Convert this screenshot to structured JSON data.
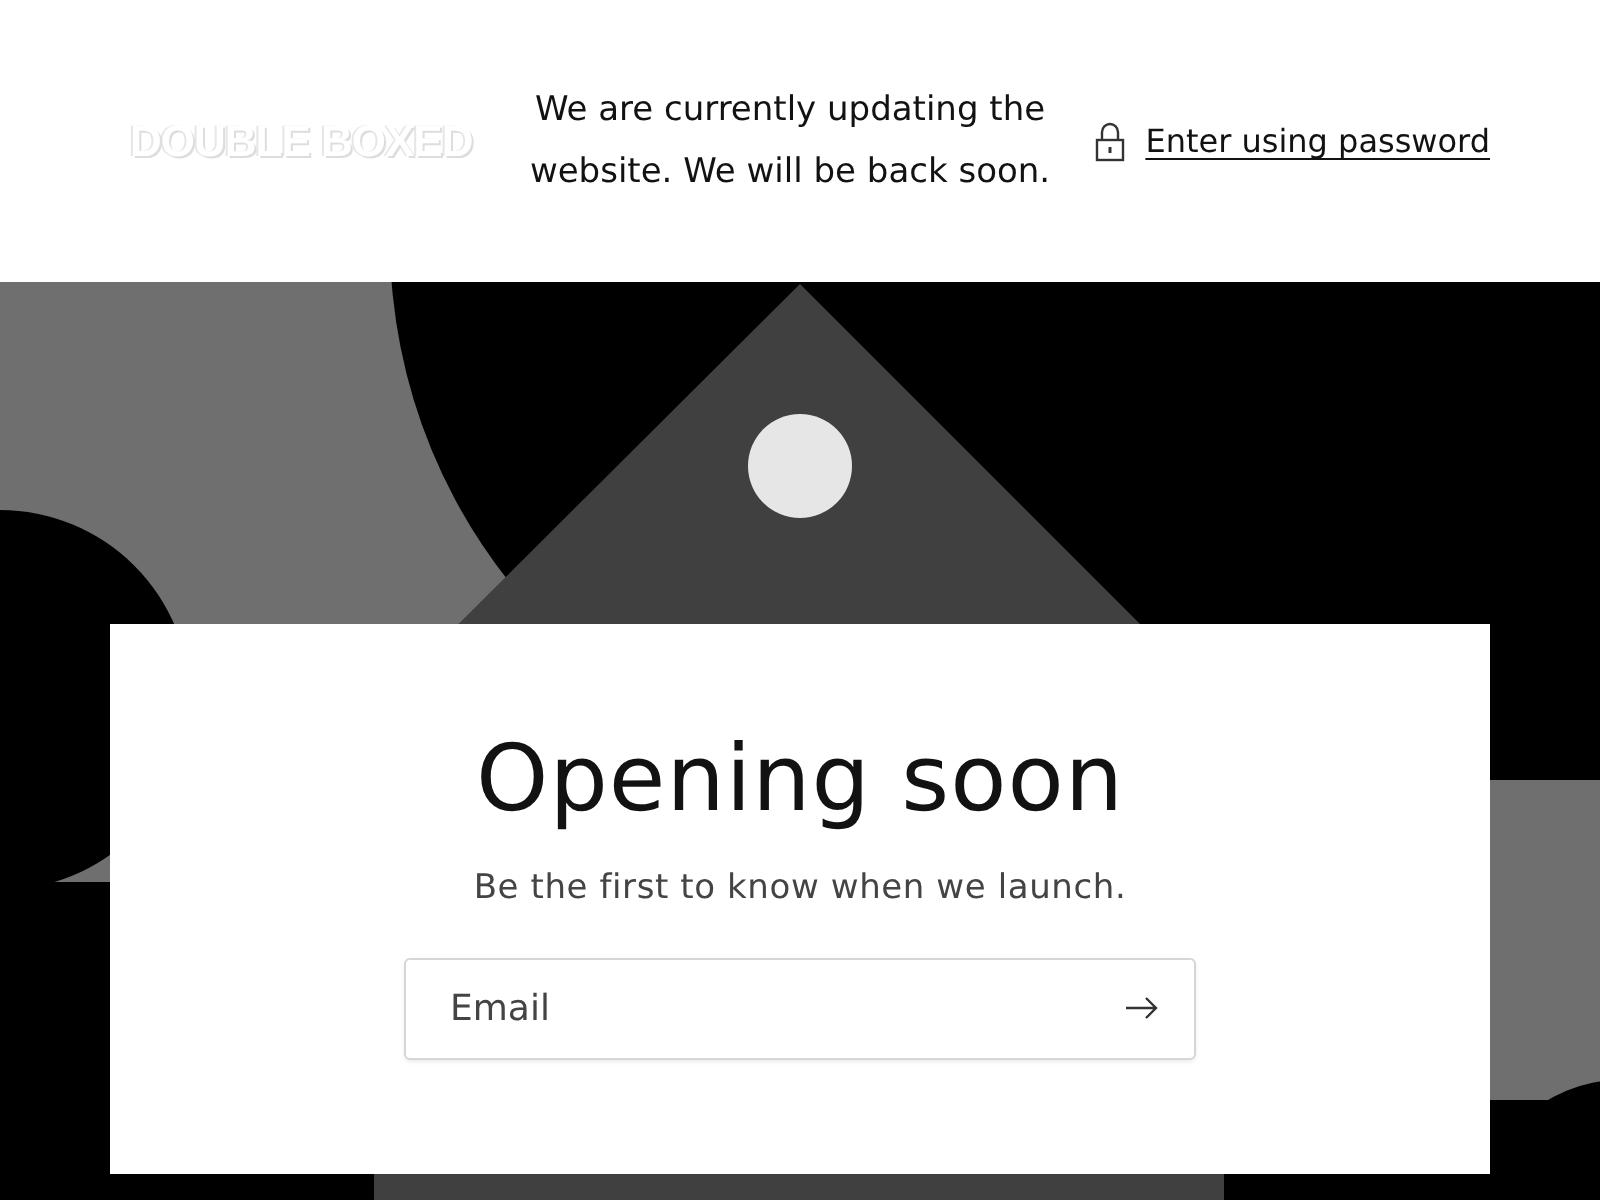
{
  "header": {
    "logo": "DOUBLE BOXED",
    "notice": "We are currently updating the website. We will be back soon.",
    "password_link": "Enter using password"
  },
  "signup": {
    "title": "Opening soon",
    "subtitle": "Be the first to know when we launch.",
    "email": {
      "placeholder": "Email"
    }
  }
}
